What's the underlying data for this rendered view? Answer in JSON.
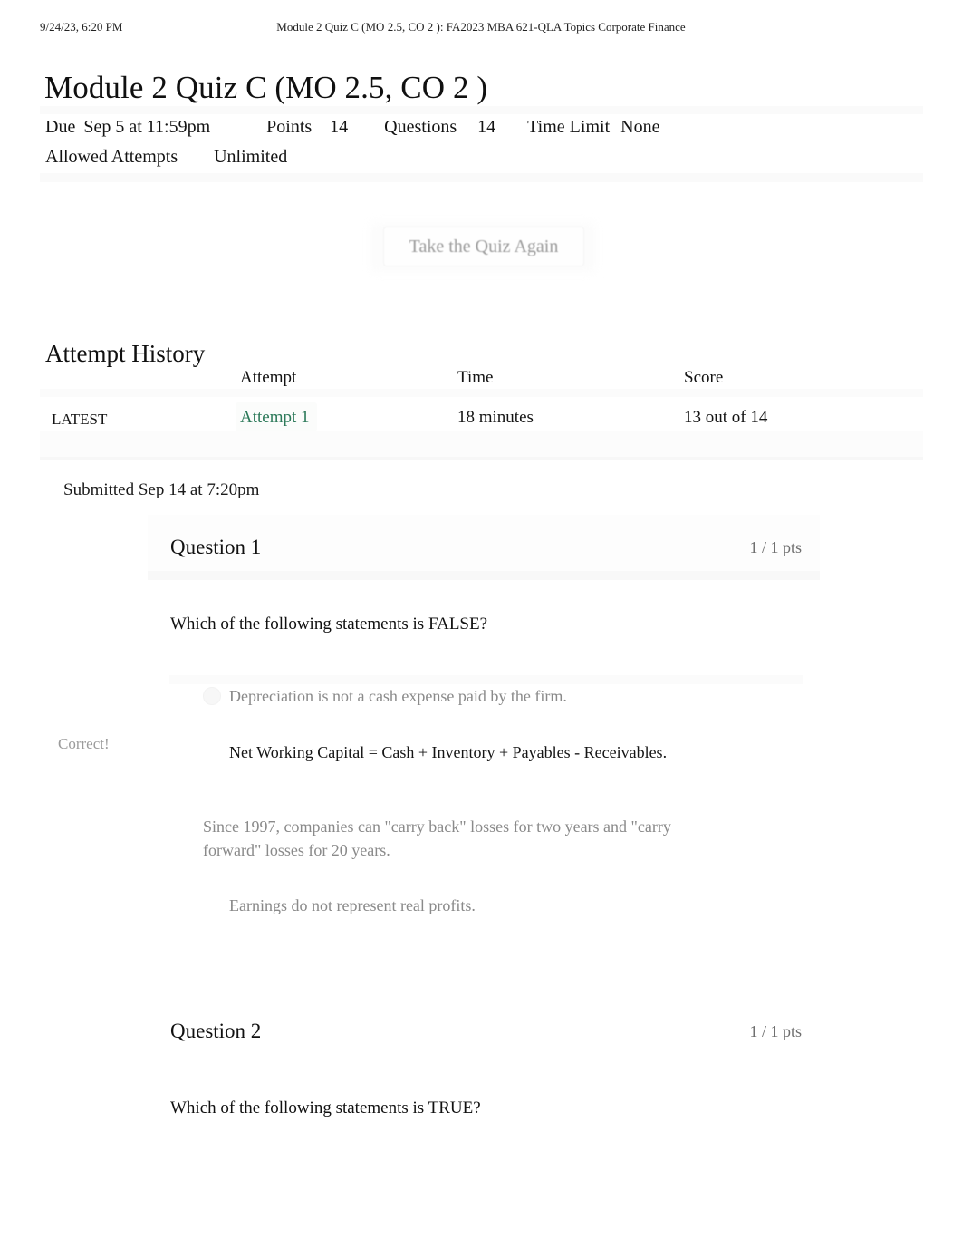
{
  "print_header": {
    "datetime": "9/24/23, 6:20 PM",
    "document_title": "Module 2 Quiz C (MO 2.5, CO 2 ): FA2023 MBA 621-QLA Topics Corporate Finance"
  },
  "page": {
    "title": "Module 2 Quiz C (MO 2.5, CO 2 )"
  },
  "quiz_meta": {
    "due_label": "Due",
    "due_value": "Sep 5 at 11:59pm",
    "points_label": "Points",
    "points_value": "14",
    "questions_label": "Questions",
    "questions_value": "14",
    "time_limit_label": "Time Limit",
    "time_limit_value": "None",
    "allowed_attempts_label": "Allowed Attempts",
    "allowed_attempts_value": "Unlimited"
  },
  "actions": {
    "retake_label": "Take the Quiz Again"
  },
  "attempt_history": {
    "heading": "Attempt History",
    "columns": {
      "kept": "",
      "attempt": "Attempt",
      "time": "Time",
      "score": "Score"
    },
    "rows": [
      {
        "kept": "LATEST",
        "attempt": "Attempt 1",
        "time": "18 minutes",
        "score": "13 out of 14"
      }
    ]
  },
  "submission": {
    "submitted_text": "Submitted Sep 14 at 7:20pm"
  },
  "questions": [
    {
      "name": "Question 1",
      "points": "1 / 1 pts",
      "prompt": "Which of the following statements is FALSE?",
      "correct_flag": "Correct!",
      "answers": [
        {
          "text": "Depreciation is not a cash expense paid by the firm.",
          "selected": false
        },
        {
          "text": "Net Working Capital = Cash + Inventory + Payables - Receivables.",
          "selected": true
        },
        {
          "text": "Since 1997, companies can \"carry back\" losses for two years and \"carry forward\" losses for 20 years.",
          "selected": false
        },
        {
          "text": "Earnings do not represent real profits.",
          "selected": false
        }
      ]
    },
    {
      "name": "Question 2",
      "points": "1 / 1 pts",
      "prompt": "Which of the following statements is TRUE?",
      "correct_flag": "",
      "answers": []
    }
  ],
  "colors": {
    "link_green": "#2d7a5a",
    "muted_text": "#8a8a8a",
    "body_text": "#1a1a1a"
  }
}
